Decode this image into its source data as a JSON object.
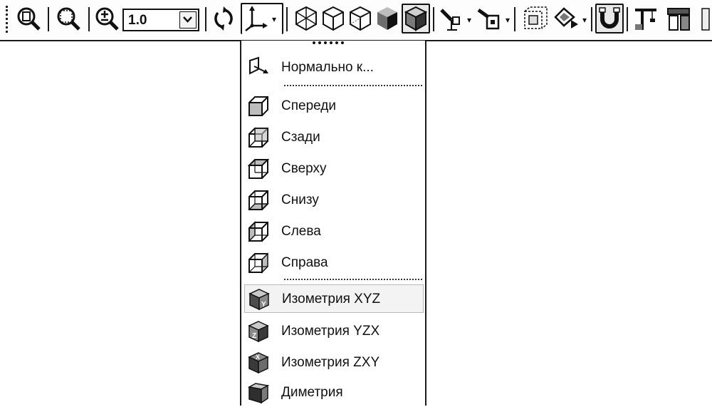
{
  "toolbar": {
    "zoom_value": "1.0"
  },
  "view_menu": {
    "items": [
      {
        "label": "Нормально к...",
        "icon": "normal-to-icon"
      },
      {
        "label": "Спереди",
        "icon": "view-front-icon"
      },
      {
        "label": "Сзади",
        "icon": "view-back-icon"
      },
      {
        "label": "Сверху",
        "icon": "view-top-icon"
      },
      {
        "label": "Снизу",
        "icon": "view-bottom-icon"
      },
      {
        "label": "Слева",
        "icon": "view-left-icon"
      },
      {
        "label": "Справа",
        "icon": "view-right-icon"
      },
      {
        "label": "Изометрия XYZ",
        "icon": "iso-xyz-icon"
      },
      {
        "label": "Изометрия YZX",
        "icon": "iso-yzx-icon"
      },
      {
        "label": "Изометрия ZXY",
        "icon": "iso-zxy-icon"
      },
      {
        "label": "Диметрия",
        "icon": "dimetry-icon"
      }
    ],
    "iso_letters": [
      "Y",
      "Z",
      "X"
    ]
  }
}
